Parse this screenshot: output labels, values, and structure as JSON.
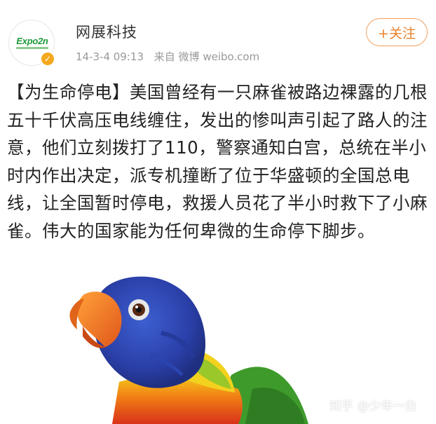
{
  "account": {
    "name": "网展科技",
    "avatar_logo_text": "Expo2n",
    "avatar_icon": "expoon-logo",
    "verified_icon": "verified-badge-icon"
  },
  "meta": {
    "timestamp": "14-3-4 09:13",
    "source": "来自 微博 weibo.com"
  },
  "follow_button": {
    "label": "+关注"
  },
  "post": {
    "text": "【为生命停电】美国曾经有一只麻雀被路边裸露的几根五十千伏高压电线缠住，发出的惨叫声引起了路人的注意，他们立刻拨打了110，警察通知白宫，总统在半小时内作出决定，派专机撞断了位于华盛顿的全国总电线，让全国暂时停电，救援人员花了半小时救下了小麻雀。伟大的国家能为任何卑微的生命停下脚步。"
  },
  "image": {
    "subject": "rainbow lorikeet parrot"
  },
  "watermark": {
    "text": "知乎 @少年一白"
  },
  "colors": {
    "follow_accent": "#e8822c",
    "verified": "#f4a81d",
    "meta_gray": "#999999",
    "text": "#222222"
  }
}
